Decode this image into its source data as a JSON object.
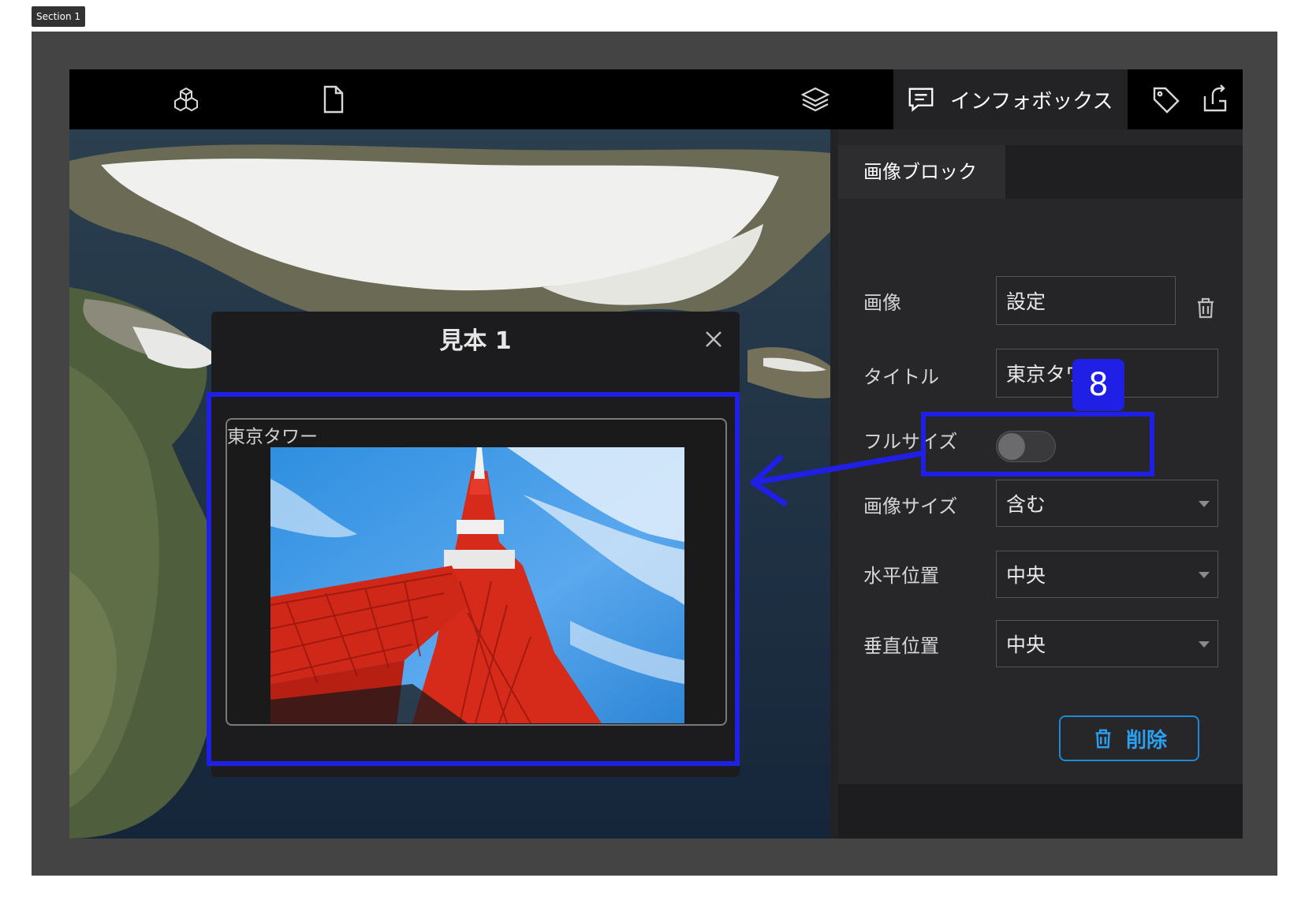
{
  "section_tag": "Section 1",
  "toolbar": {
    "left_icons": [
      "cubes-icon",
      "file-icon"
    ],
    "right_icons": [
      "layers-icon",
      "infobox-icon",
      "tag-icon",
      "export-icon"
    ],
    "active_tab_label": "インフォボックス"
  },
  "panel": {
    "tab_label": "画像ブロック",
    "image_label": "画像",
    "image_value": "設定",
    "title_label": "タイトル",
    "title_value": "東京タワー",
    "fullsize_label": "フルサイズ",
    "fullsize_on": false,
    "image_size_label": "画像サイズ",
    "image_size_value": "含む",
    "h_pos_label": "水平位置",
    "h_pos_value": "中央",
    "v_pos_label": "垂直位置",
    "v_pos_value": "中央",
    "delete_label": "削除"
  },
  "popup": {
    "title": "見本 1",
    "content_title": "東京タワー",
    "image": "tokyo-tower-photo"
  },
  "annotation": {
    "badge_number": "8",
    "color": "#1f1fe6"
  },
  "colors": {
    "accent_blue": "#1e88d9",
    "annotation_blue": "#1f1fe6",
    "toolbar_bg": "#000000",
    "panel_bg": "#27272a"
  }
}
